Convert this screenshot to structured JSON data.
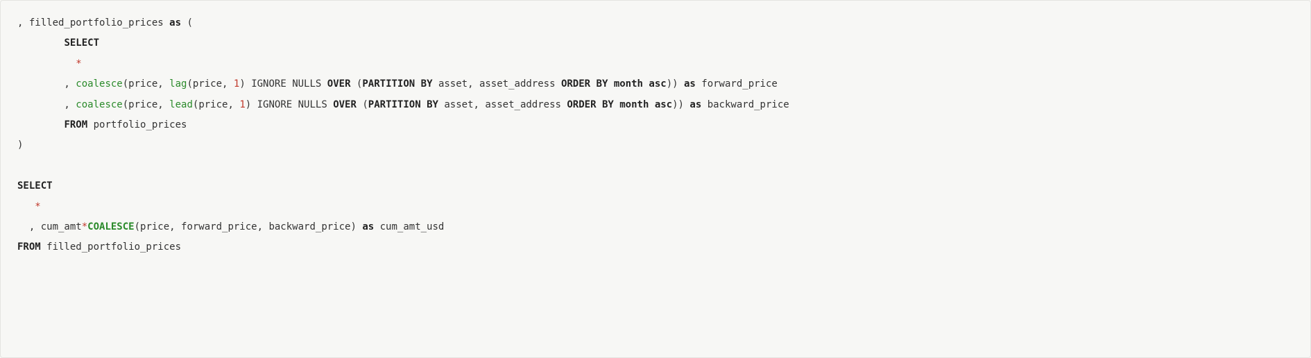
{
  "code": {
    "tokens": [
      {
        "t": ", filled_portfolio_prices "
      },
      {
        "t": "as",
        "c": "kw"
      },
      {
        "t": " (\n"
      },
      {
        "t": "        "
      },
      {
        "t": "SELECT",
        "c": "kw"
      },
      {
        "t": "\n"
      },
      {
        "t": "          "
      },
      {
        "t": "*",
        "c": "star"
      },
      {
        "t": "\n"
      },
      {
        "t": "        , "
      },
      {
        "t": "coalesce",
        "c": "fn"
      },
      {
        "t": "(price, "
      },
      {
        "t": "lag",
        "c": "fn"
      },
      {
        "t": "(price, "
      },
      {
        "t": "1",
        "c": "num"
      },
      {
        "t": ") IGNORE NULLS "
      },
      {
        "t": "OVER",
        "c": "kw"
      },
      {
        "t": " ("
      },
      {
        "t": "PARTITION BY",
        "c": "kw"
      },
      {
        "t": " asset, asset_address "
      },
      {
        "t": "ORDER BY",
        "c": "kw"
      },
      {
        "t": " "
      },
      {
        "t": "month asc",
        "c": "kw"
      },
      {
        "t": ")) "
      },
      {
        "t": "as",
        "c": "kw"
      },
      {
        "t": " forward_price\n"
      },
      {
        "t": "        , "
      },
      {
        "t": "coalesce",
        "c": "fn"
      },
      {
        "t": "(price, "
      },
      {
        "t": "lead",
        "c": "fn"
      },
      {
        "t": "(price, "
      },
      {
        "t": "1",
        "c": "num"
      },
      {
        "t": ") IGNORE NULLS "
      },
      {
        "t": "OVER",
        "c": "kw"
      },
      {
        "t": " ("
      },
      {
        "t": "PARTITION BY",
        "c": "kw"
      },
      {
        "t": " asset, asset_address "
      },
      {
        "t": "ORDER BY",
        "c": "kw"
      },
      {
        "t": " "
      },
      {
        "t": "month asc",
        "c": "kw"
      },
      {
        "t": ")) "
      },
      {
        "t": "as",
        "c": "kw"
      },
      {
        "t": " backward_price\n"
      },
      {
        "t": "        "
      },
      {
        "t": "FROM",
        "c": "kw"
      },
      {
        "t": " portfolio_prices\n"
      },
      {
        "t": ")\n"
      },
      {
        "t": "\n"
      },
      {
        "t": "SELECT",
        "c": "kw"
      },
      {
        "t": "\n"
      },
      {
        "t": "   "
      },
      {
        "t": "*",
        "c": "star"
      },
      {
        "t": "\n"
      },
      {
        "t": "  , cum_amt"
      },
      {
        "t": "*",
        "c": "op"
      },
      {
        "t": "COALESCE",
        "c": "fnU"
      },
      {
        "t": "(price, forward_price, backward_price) "
      },
      {
        "t": "as",
        "c": "kw"
      },
      {
        "t": " cum_amt_usd\n"
      },
      {
        "t": "FROM",
        "c": "kw"
      },
      {
        "t": " filled_portfolio_prices"
      }
    ]
  }
}
